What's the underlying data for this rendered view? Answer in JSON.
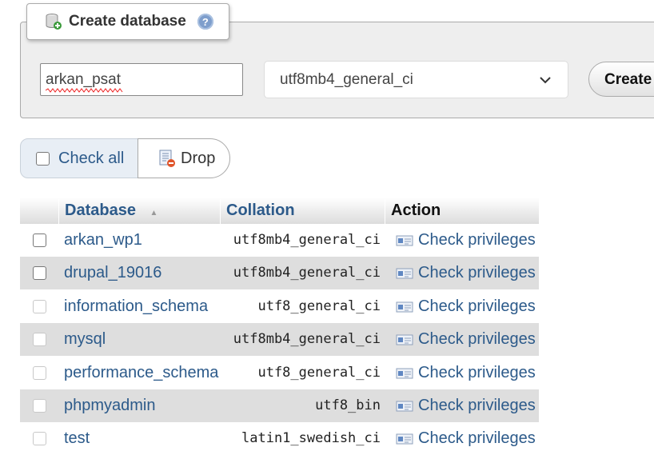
{
  "create_database": {
    "legend": "Create database",
    "name_value": "arkan_psat",
    "collation_value": "utf8mb4_general_ci",
    "create_label": "Create"
  },
  "toolbar": {
    "check_all_label": "Check all",
    "drop_label": "Drop"
  },
  "table": {
    "headers": {
      "database": "Database",
      "sort_indicator": "▲",
      "collation": "Collation",
      "action": "Action"
    },
    "rows": [
      {
        "name": "arkan_wp1",
        "collation": "utf8mb4_general_ci",
        "action": "Check privileges",
        "checkable": true
      },
      {
        "name": "drupal_19016",
        "collation": "utf8mb4_general_ci",
        "action": "Check privileges",
        "checkable": true
      },
      {
        "name": "information_schema",
        "collation": "utf8_general_ci",
        "action": "Check privileges",
        "checkable": false
      },
      {
        "name": "mysql",
        "collation": "utf8mb4_general_ci",
        "action": "Check privileges",
        "checkable": false
      },
      {
        "name": "performance_schema",
        "collation": "utf8_general_ci",
        "action": "Check privileges",
        "checkable": false
      },
      {
        "name": "phpmyadmin",
        "collation": "utf8_bin",
        "action": "Check privileges",
        "checkable": false
      },
      {
        "name": "test",
        "collation": "latin1_swedish_ci",
        "action": "Check privileges",
        "checkable": false
      }
    ]
  },
  "colors": {
    "link": "#2c5a8a",
    "row_alt": "#dedede",
    "panel": "#eeeeee"
  },
  "icons": [
    "database-add-icon",
    "help-icon",
    "chevron-down-icon",
    "drop-icon",
    "check-privileges-icon"
  ]
}
